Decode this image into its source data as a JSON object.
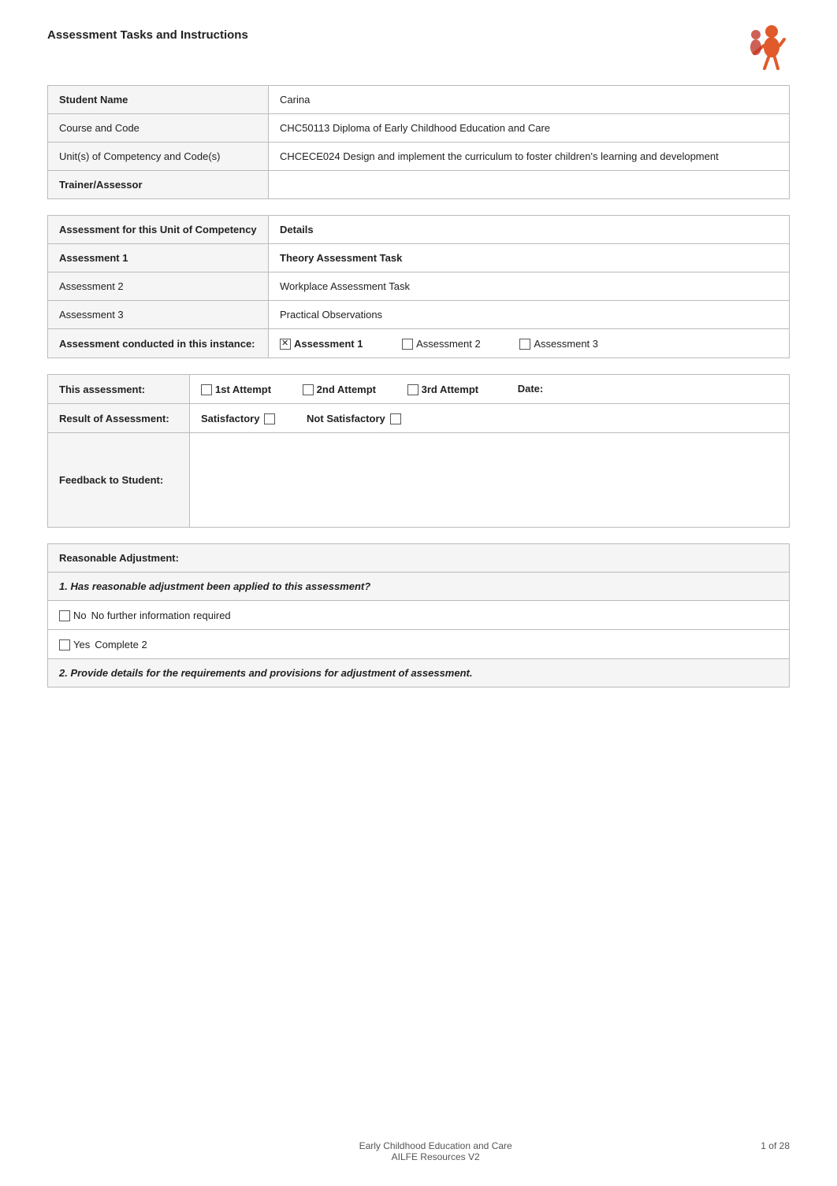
{
  "header": {
    "title": "Assessment Tasks and Instructions"
  },
  "info_rows": [
    {
      "label": "Student Name",
      "value": "Carina",
      "label_bold": true
    },
    {
      "label": "Course and Code",
      "value": "CHC50113 Diploma of Early Childhood Education and Care",
      "label_bold": false
    },
    {
      "label": "Unit(s) of Competency and Code(s)",
      "value": "CHCECE024 Design and implement the curriculum to foster children's learning and development",
      "label_bold": false
    },
    {
      "label": "Trainer/Assessor",
      "value": "",
      "label_bold": true
    }
  ],
  "competency_header": {
    "col1": "Assessment for this Unit of Competency",
    "col2": "Details"
  },
  "competency_rows": [
    {
      "label": "Assessment 1",
      "value": "Theory Assessment Task",
      "label_bold": true,
      "value_bold": true
    },
    {
      "label": "Assessment 2",
      "value": "Workplace Assessment Task",
      "label_bold": false,
      "value_bold": false
    },
    {
      "label": "Assessment 3",
      "value": "Practical Observations",
      "label_bold": false,
      "value_bold": false
    }
  ],
  "instance_row": {
    "label": "Assessment conducted in this instance:",
    "assessment1": "Assessment 1",
    "assessment2": "Assessment 2",
    "assessment3": "Assessment 3",
    "a1_checked": true,
    "a2_checked": false,
    "a3_checked": false
  },
  "attempt_row": {
    "label": "This assessment:",
    "attempt1_label": "1st Attempt",
    "attempt2_label": "2nd Attempt",
    "attempt3_label": "3rd Attempt",
    "date_label": "Date:",
    "a1_checked": false,
    "a2_checked": false,
    "a3_checked": false
  },
  "result_row": {
    "label": "Result of Assessment:",
    "satisfactory_label": "Satisfactory",
    "not_satisfactory_label": "Not Satisfactory",
    "sat_checked": false,
    "not_sat_checked": false
  },
  "feedback_row": {
    "label": "Feedback to Student:"
  },
  "reasonable_adjustment": {
    "header": "Reasonable Adjustment:",
    "q1": "1.   Has reasonable adjustment been applied to this assessment?",
    "no_option": "No",
    "no_detail": "No further information required",
    "yes_option": "Yes",
    "yes_detail": "Complete 2",
    "q2": "2.   Provide details for the requirements and provisions for adjustment of assessment."
  },
  "footer": {
    "center_line1": "Early Childhood Education and Care",
    "center_line2": "AILFE Resources V2",
    "page_info": "1 of 28"
  }
}
